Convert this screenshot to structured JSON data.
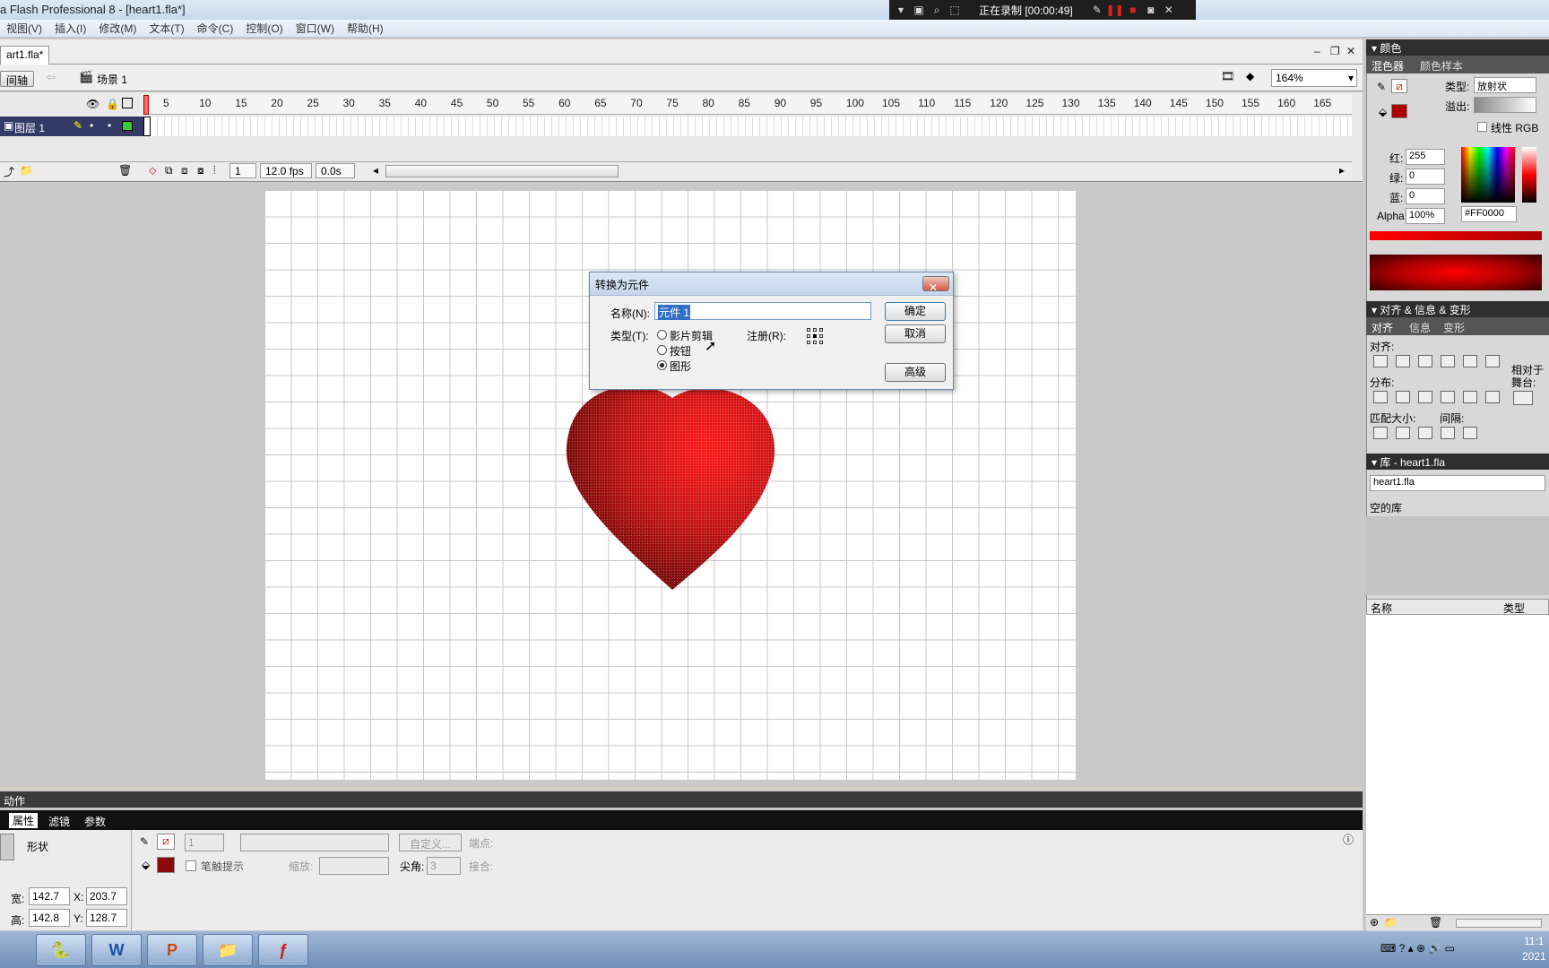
{
  "window": {
    "title": "a Flash Professional 8 - [heart1.fla*]"
  },
  "recorder": {
    "status": "正在录制 [00:00:49]"
  },
  "menu": [
    "视图(V)",
    "插入(I)",
    "修改(M)",
    "文本(T)",
    "命令(C)",
    "控制(O)",
    "窗口(W)",
    "帮助(H)"
  ],
  "document": {
    "tab": "art1.fla*",
    "timeline_button": "间轴",
    "scene": "场景 1",
    "zoom": "164%"
  },
  "timeline": {
    "frame_numbers": [
      "5",
      "10",
      "15",
      "20",
      "25",
      "30",
      "35",
      "40",
      "45",
      "50",
      "55",
      "60",
      "65",
      "70",
      "75",
      "80",
      "85",
      "90",
      "95",
      "100",
      "105",
      "110",
      "115",
      "120",
      "125",
      "130",
      "135",
      "140",
      "145",
      "150",
      "155",
      "160",
      "165"
    ],
    "layer_name": "图层 1",
    "current_frame": "1",
    "fps": "12.0 fps",
    "time": "0.0s"
  },
  "dialog": {
    "title": "转换为元件",
    "name_label": "名称(N):",
    "name_value": "元件 1",
    "type_label": "类型(T):",
    "types": [
      "影片剪辑",
      "按钮",
      "图形"
    ],
    "selected_type": "图形",
    "registration_label": "注册(R):",
    "ok": "确定",
    "cancel": "取消",
    "advanced": "高级"
  },
  "actions_panel": {
    "title": "动作"
  },
  "properties": {
    "tabs": [
      "属性",
      "滤镜",
      "参数"
    ],
    "shape_label": "形状",
    "stroke_height": "1",
    "custom_button": "自定义...",
    "cap_label": "端点:",
    "stroke_hint": "笔触提示",
    "scale_label": "缩放:",
    "miter_label": "尖角:",
    "miter_value": "3",
    "join_label": "接合:",
    "width_label": "宽:",
    "width": "142.7",
    "height_label": "高:",
    "height": "142.8",
    "x_label": "X:",
    "x": "203.7",
    "y_label": "Y:",
    "y": "128.7"
  },
  "color_panel": {
    "header": "颜色",
    "tabs": [
      "混色器",
      "颜色样本"
    ],
    "type_label": "类型:",
    "type_value": "放射状",
    "overflow_label": "溢出:",
    "linear_rgb": "线性 RGB",
    "red_label": "红:",
    "red": "255",
    "green_label": "绿:",
    "green": "0",
    "blue_label": "蓝:",
    "blue": "0",
    "alpha_label": "Alpha:",
    "alpha": "100%",
    "hex": "#FF0000"
  },
  "align_panel": {
    "header": "对齐 & 信息 & 变形",
    "tabs": [
      "对齐",
      "信息",
      "变形"
    ],
    "align_label": "对齐:",
    "distribute_label": "分布:",
    "match_label": "匹配大小:",
    "spacing_label": "间隔:",
    "relative_label_1": "相对于",
    "relative_label_2": "舞台:"
  },
  "library_panel": {
    "header": "库 - heart1.fla",
    "doc": "heart1.fla",
    "empty": "空的库",
    "col_name": "名称",
    "col_type": "类型"
  },
  "taskbar": {
    "clock": "11:1",
    "date": "2021"
  },
  "colors": {
    "heart": "#d01818",
    "accent": "#ff0000"
  }
}
